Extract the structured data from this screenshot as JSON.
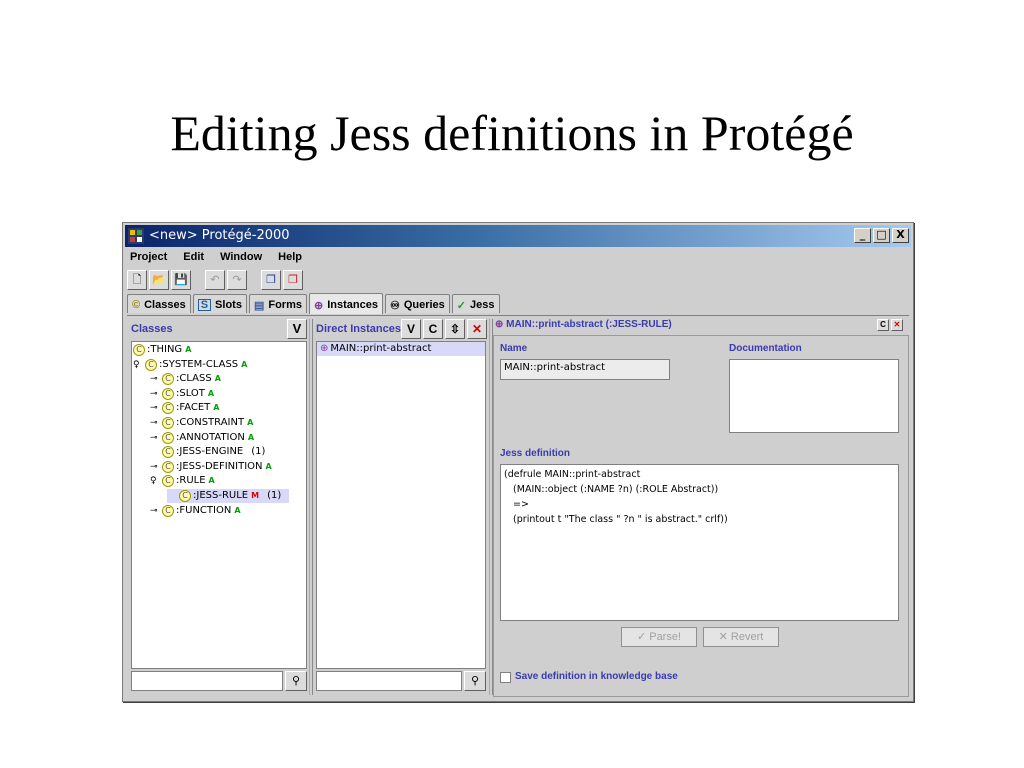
{
  "slide": {
    "title": "Editing Jess definitions in Protégé"
  },
  "window": {
    "title": "<new> Protégé-2000",
    "minimize": "_",
    "maximize": "□",
    "close": "X"
  },
  "menu": [
    "Project",
    "Edit",
    "Window",
    "Help"
  ],
  "tabs": [
    {
      "label": "Classes",
      "icon": "class-c-icon",
      "glyph": "©"
    },
    {
      "label": "Slots",
      "icon": "slot-s-icon",
      "glyph": "S"
    },
    {
      "label": "Forms",
      "icon": "form-icon",
      "glyph": "▤"
    },
    {
      "label": "Instances",
      "icon": "instance-icon",
      "glyph": "⊕"
    },
    {
      "label": "Queries",
      "icon": "binoculars-icon",
      "glyph": "🔭"
    },
    {
      "label": "Jess",
      "icon": "checkmark-icon",
      "glyph": "✓"
    }
  ],
  "classes_pane": {
    "label": "Classes",
    "v_button": "V",
    "tree": [
      {
        "label": ":THING",
        "badge": "A",
        "depth": 0
      },
      {
        "label": ":SYSTEM-CLASS",
        "badge": "A",
        "depth": 0
      },
      {
        "label": ":CLASS",
        "badge": "A",
        "depth": 1
      },
      {
        "label": ":SLOT",
        "badge": "A",
        "depth": 1
      },
      {
        "label": ":FACET",
        "badge": "A",
        "depth": 1
      },
      {
        "label": ":CONSTRAINT",
        "badge": "A",
        "depth": 1
      },
      {
        "label": ":ANNOTATION",
        "badge": "A",
        "depth": 1
      },
      {
        "label": ":JESS-ENGINE",
        "badge": "",
        "count": "(1)",
        "depth": 1
      },
      {
        "label": ":JESS-DEFINITION",
        "badge": "A",
        "depth": 1
      },
      {
        "label": ":RULE",
        "badge": "A",
        "depth": 1
      },
      {
        "label": ":JESS-RULE",
        "badge": "M",
        "count": "(1)",
        "depth": 2
      },
      {
        "label": ":FUNCTION",
        "badge": "A",
        "depth": 1
      }
    ]
  },
  "instances_pane": {
    "label": "Direct Instances",
    "buttons": [
      "V",
      "C",
      "⇳",
      "✕"
    ],
    "items": [
      "MAIN::print-abstract"
    ]
  },
  "form": {
    "header": "MAIN::print-abstract  (:JESS-RULE)",
    "header_buttons": [
      "C",
      "✕"
    ],
    "name_label": "Name",
    "name_value": "MAIN::print-abstract",
    "doc_label": "Documentation",
    "doc_value": "",
    "jess_label": "Jess definition",
    "jess_lines": [
      "(defrule MAIN::print-abstract",
      "   (MAIN::object (:NAME ?n) (:ROLE Abstract))",
      "   =>",
      "   (printout t \"The class \" ?n \" is abstract.\" crlf))"
    ],
    "parse_button": "✓ Parse!",
    "revert_button": "✕ Revert",
    "save_checkbox_label": "Save definition in knowledge base"
  }
}
